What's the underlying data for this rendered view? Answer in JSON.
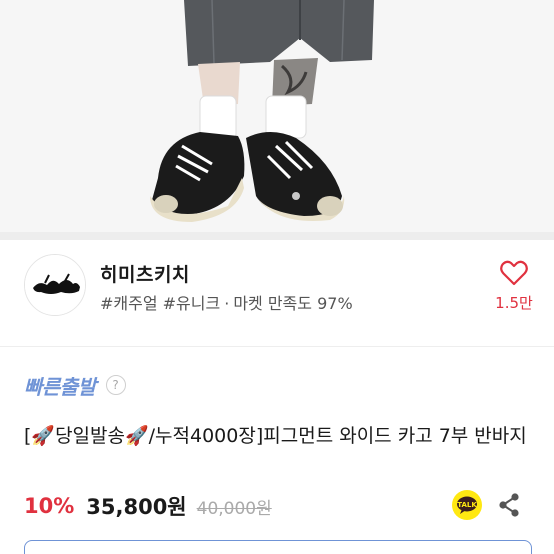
{
  "shop": {
    "name": "히미츠키치",
    "tags": "#캐주얼 #유니크",
    "separator": "·",
    "satisfaction": "마켓 만족도 97%",
    "like_count": "1.5만",
    "logo_icon": "shop-logo-wordmark"
  },
  "badge": {
    "fast_shipping": "빠른출발",
    "help": "?"
  },
  "product": {
    "title": "[🚀당일발송🚀/누적4000장]피그먼트 와이드 카고 7부 반바지",
    "discount": "10%",
    "price": "35,800원",
    "original_price": "40,000원"
  },
  "icons": {
    "like": "heart-outline-icon",
    "talk": "kakaotalk-icon",
    "share": "share-icon",
    "help": "question-circle-icon"
  },
  "colors": {
    "accent_red": "#e0313f",
    "fast_blue": "#6f93d6",
    "talk_yellow": "#ffe812"
  }
}
